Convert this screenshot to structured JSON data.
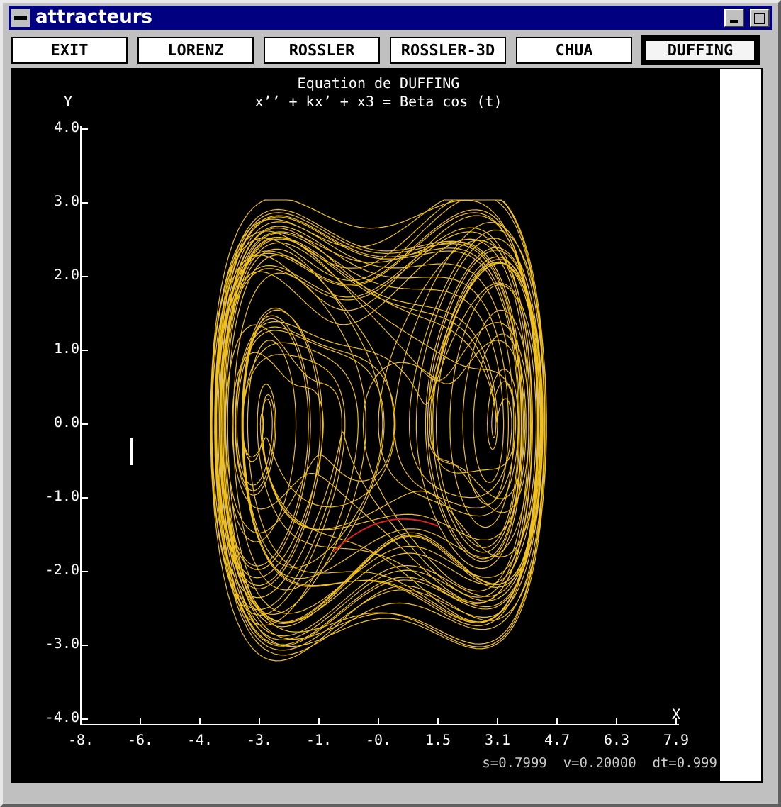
{
  "window": {
    "title": "attracteurs"
  },
  "buttons": [
    {
      "label": "EXIT",
      "selected": false
    },
    {
      "label": "LORENZ",
      "selected": false
    },
    {
      "label": "ROSSLER",
      "selected": false
    },
    {
      "label": "ROSSLER-3D",
      "selected": false
    },
    {
      "label": "CHUA",
      "selected": false
    },
    {
      "label": "DUFFING",
      "selected": true
    }
  ],
  "plot": {
    "title": "Equation de DUFFING",
    "subtitle": "x’’ + kx’ + x3 = Beta cos (t)",
    "y_axis_label": "Y",
    "x_axis_label": "X",
    "y_ticks": [
      "4.0",
      "3.0",
      "2.0",
      "1.0",
      "0.0",
      "-1.0",
      "-2.0",
      "-3.0",
      "-4.0"
    ],
    "x_ticks": [
      "-8.",
      "-6.",
      "-4.",
      "-3.",
      "-1.",
      "-0.",
      "1.5",
      "3.1",
      "4.7",
      "6.3",
      "7.9"
    ],
    "status": [
      "s=0.7999",
      "v=0.20000",
      "dt=0.999"
    ]
  }
}
